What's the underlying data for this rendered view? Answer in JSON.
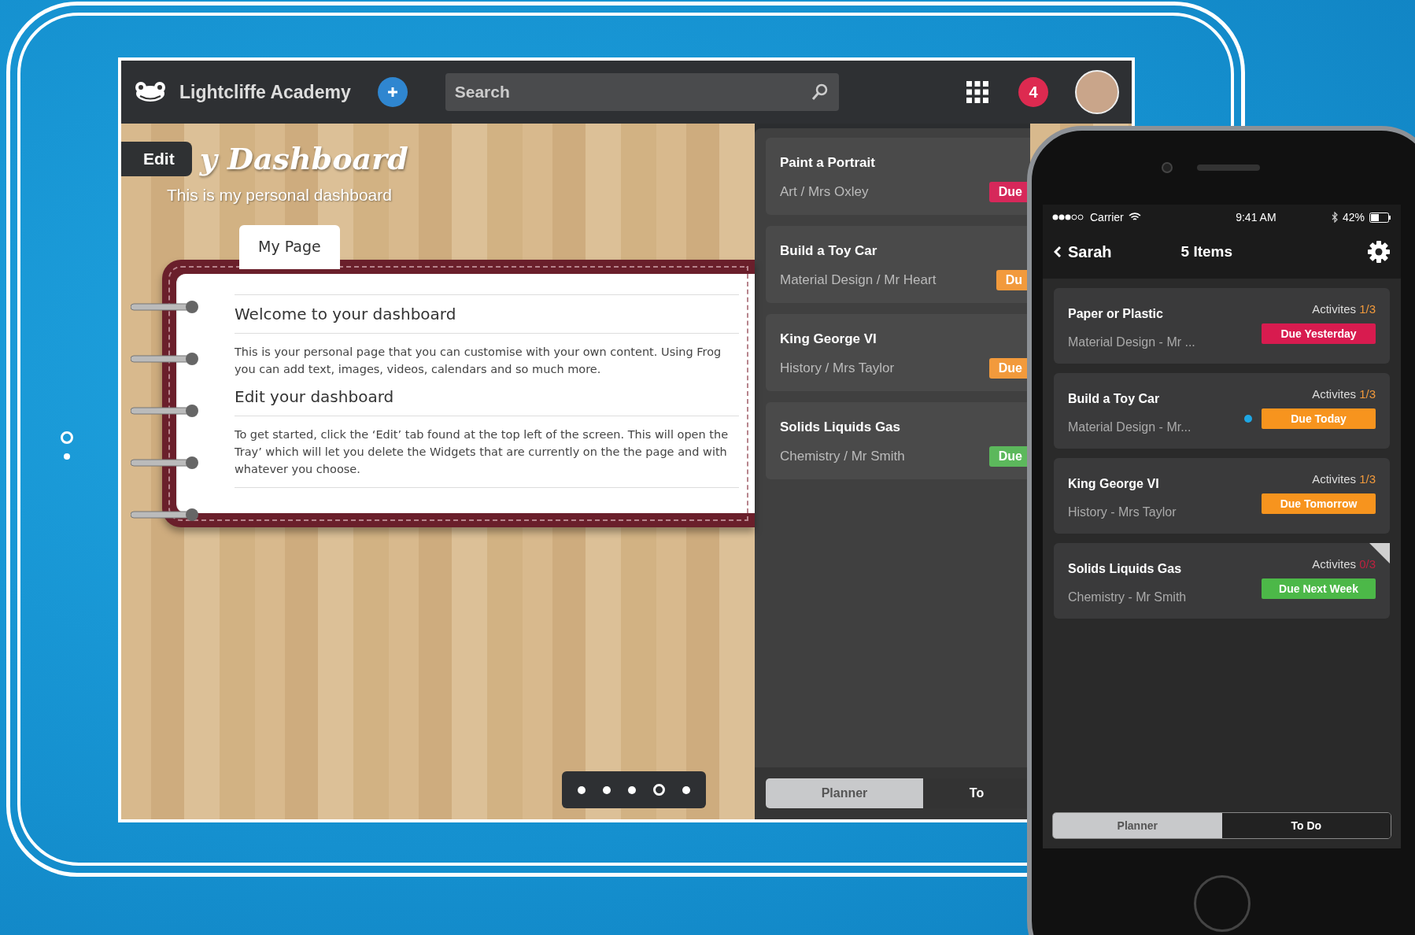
{
  "tablet": {
    "school_name": "Lightcliffe Academy",
    "search": {
      "placeholder": "Search"
    },
    "notification_count": "4",
    "edit_tab": "Edit",
    "dashboard_title": "y Dashboard",
    "dashboard_subtitle": "This is my personal dashboard",
    "page_tab": "My Page",
    "sections": [
      {
        "heading": "Welcome to your dashboard",
        "text": "This is your personal page that you can customise with your own content. Using Frog you can add text, images, videos, calendars and so much more."
      },
      {
        "heading": "Edit your dashboard",
        "text": "To get started, click the ‘Edit’ tab found at the top left of the screen. This will open the Tray’ which will let you delete the Widgets that are currently on the the page and with whatever you choose."
      }
    ],
    "pager": [
      {
        "selected": false
      },
      {
        "selected": false
      },
      {
        "selected": false
      },
      {
        "selected": true
      },
      {
        "selected": false
      }
    ],
    "planner": {
      "items": [
        {
          "title": "Paint a Portrait",
          "subtitle": "Art / Mrs Oxley",
          "badge": "Due",
          "color": "#d6285a"
        },
        {
          "title": "Build a Toy Car",
          "subtitle": "Material Design / Mr Heart",
          "badge": "Du",
          "color": "#f29a3c"
        },
        {
          "title": "King George VI",
          "subtitle": "History / Mrs Taylor",
          "badge": "Due",
          "color": "#f29a3c"
        },
        {
          "title": "Solids Liquids Gas",
          "subtitle": "Chemistry / Mr Smith",
          "badge": "Due",
          "color": "#5cb85c"
        }
      ],
      "tabs": [
        {
          "label": "Planner",
          "selected": true
        },
        {
          "label": "To",
          "selected": false
        }
      ]
    }
  },
  "phone": {
    "status": {
      "carrier": "Carrier",
      "time": "9:41 AM",
      "battery": "42%"
    },
    "back_label": "Sarah",
    "title": "5 Items",
    "items": [
      {
        "title": "Paper or Plastic",
        "subtitle": "Material Design - Mr ...",
        "activities_label": "Activites",
        "activities": {
          "value": "1/3",
          "color": "#f29a3c"
        },
        "badge": "Due Yesterday",
        "color": "#d81b4f",
        "unread": false,
        "flagged": false
      },
      {
        "title": "Build a Toy Car",
        "subtitle": "Material Design - Mr...",
        "activities_label": "Activites",
        "activities": {
          "value": "1/3",
          "color": "#f29a3c"
        },
        "badge": "Due Today",
        "color": "#f7941e",
        "unread": true,
        "flagged": false
      },
      {
        "title": "King George VI",
        "subtitle": "History - Mrs Taylor",
        "activities_label": "Activites",
        "activities": {
          "value": "1/3",
          "color": "#f29a3c"
        },
        "badge": "Due Tomorrow",
        "color": "#f7941e",
        "unread": false,
        "flagged": false
      },
      {
        "title": "Solids Liquids Gas",
        "subtitle": "Chemistry - Mr Smith",
        "activities_label": "Activites",
        "activities": {
          "value": "0/3",
          "color": "#c0213f"
        },
        "badge": "Due Next Week",
        "color": "#4cb848",
        "unread": false,
        "flagged": true
      }
    ],
    "tabs": [
      {
        "label": "Planner",
        "selected": true
      },
      {
        "label": "To Do",
        "selected": false
      }
    ]
  }
}
